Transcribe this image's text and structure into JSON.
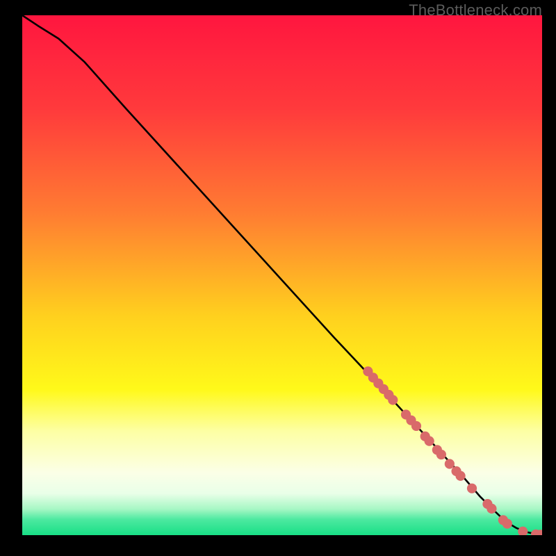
{
  "watermark": "TheBottleneck.com",
  "colors": {
    "gradient_stops": [
      {
        "pct": 0,
        "color": "#ff163f"
      },
      {
        "pct": 18,
        "color": "#ff3a3c"
      },
      {
        "pct": 38,
        "color": "#ff7c32"
      },
      {
        "pct": 58,
        "color": "#ffd11e"
      },
      {
        "pct": 72,
        "color": "#fff91a"
      },
      {
        "pct": 80,
        "color": "#fdffa4"
      },
      {
        "pct": 88,
        "color": "#fbffe7"
      },
      {
        "pct": 92,
        "color": "#e9ffe8"
      },
      {
        "pct": 95,
        "color": "#a6f7c4"
      },
      {
        "pct": 97,
        "color": "#4ce9a0"
      },
      {
        "pct": 100,
        "color": "#18df86"
      }
    ],
    "curve": "#000000",
    "marker": "#d96a6a",
    "frame": "#000000"
  },
  "chart_data": {
    "type": "line",
    "title": "",
    "xlabel": "",
    "ylabel": "",
    "xlim": [
      0,
      100
    ],
    "ylim": [
      0,
      100
    ],
    "series": [
      {
        "name": "curve",
        "x": [
          0,
          3,
          7,
          12,
          20,
          30,
          40,
          50,
          60,
          68,
          74,
          80,
          85,
          88,
          91,
          93,
          95,
          97,
          99,
          100
        ],
        "y": [
          100,
          98,
          95.5,
          91,
          82,
          71,
          60,
          49,
          38,
          29.5,
          23,
          16.5,
          11,
          7.5,
          4.5,
          2.6,
          1.4,
          0.6,
          0.15,
          0.1
        ]
      }
    ],
    "markers": [
      {
        "x": 66.5,
        "y": 31.5
      },
      {
        "x": 67.5,
        "y": 30.3
      },
      {
        "x": 68.5,
        "y": 29.2
      },
      {
        "x": 69.5,
        "y": 28.1
      },
      {
        "x": 70.5,
        "y": 27.0
      },
      {
        "x": 71.3,
        "y": 26.0
      },
      {
        "x": 73.8,
        "y": 23.2
      },
      {
        "x": 74.8,
        "y": 22.1
      },
      {
        "x": 75.8,
        "y": 21.0
      },
      {
        "x": 77.5,
        "y": 19.0
      },
      {
        "x": 78.3,
        "y": 18.1
      },
      {
        "x": 79.8,
        "y": 16.4
      },
      {
        "x": 80.6,
        "y": 15.5
      },
      {
        "x": 82.2,
        "y": 13.7
      },
      {
        "x": 83.5,
        "y": 12.3
      },
      {
        "x": 84.3,
        "y": 11.4
      },
      {
        "x": 86.5,
        "y": 9.0
      },
      {
        "x": 89.5,
        "y": 6.0
      },
      {
        "x": 90.3,
        "y": 5.1
      },
      {
        "x": 92.5,
        "y": 2.9
      },
      {
        "x": 93.3,
        "y": 2.2
      },
      {
        "x": 96.3,
        "y": 0.7
      },
      {
        "x": 98.8,
        "y": 0.15
      },
      {
        "x": 99.7,
        "y": 0.1
      }
    ]
  }
}
